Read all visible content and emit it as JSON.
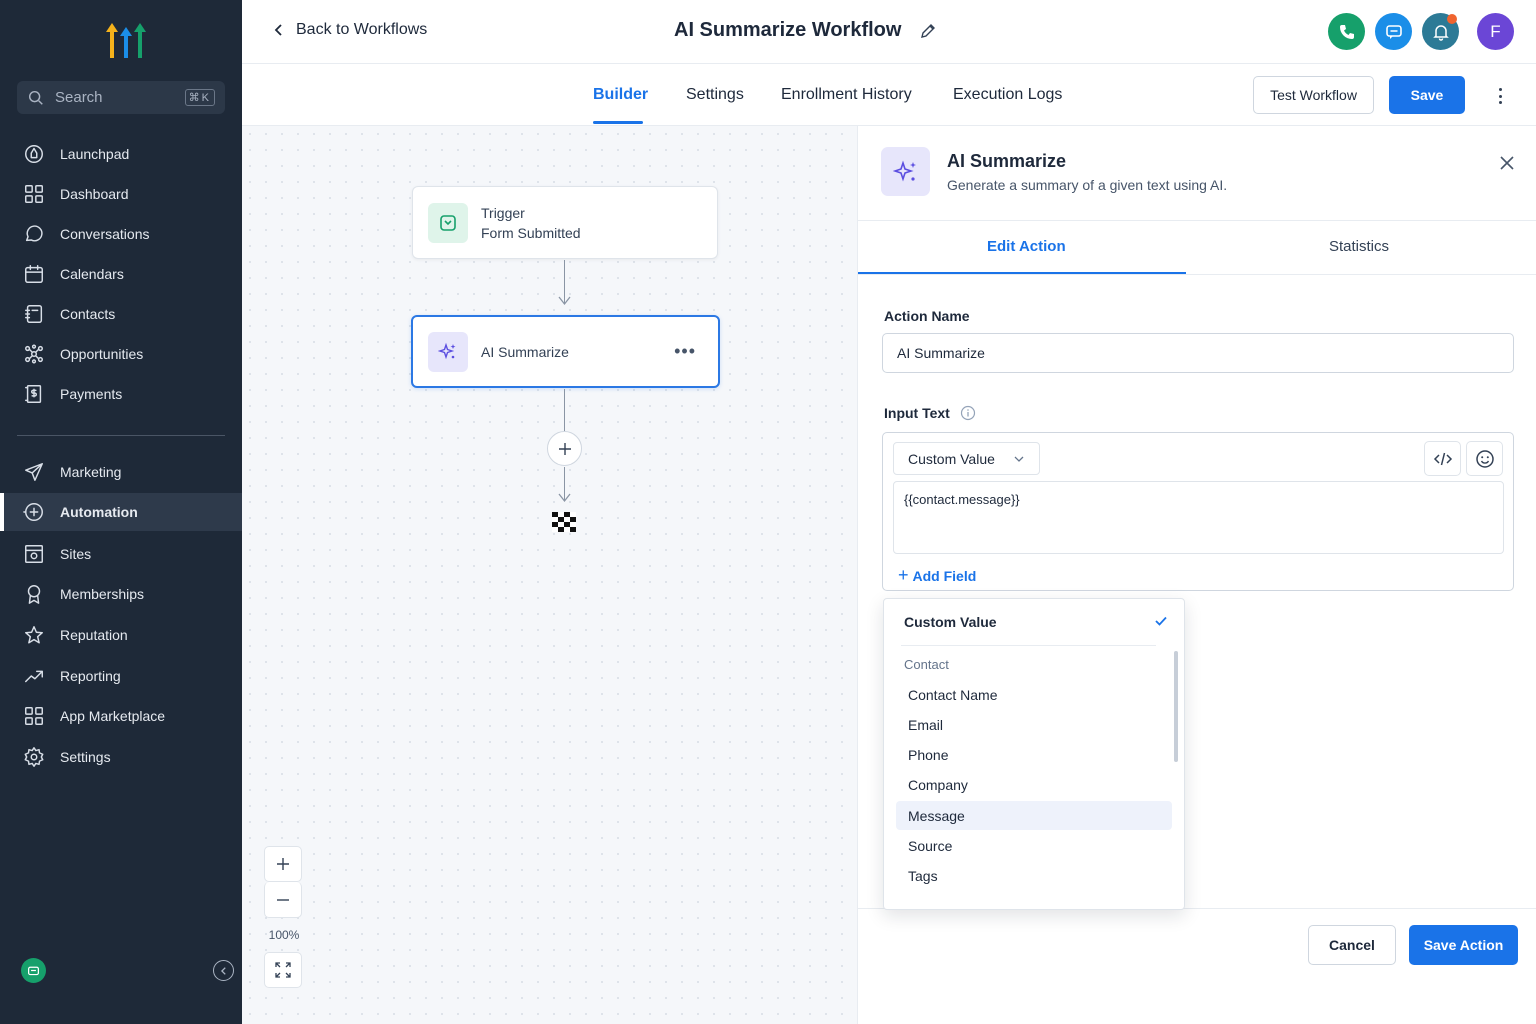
{
  "sidebar": {
    "search_placeholder": "Search",
    "search_shortcut": "⌘K",
    "items": [
      {
        "label": "Launchpad",
        "icon": "launchpad-icon"
      },
      {
        "label": "Dashboard",
        "icon": "dashboard-icon"
      },
      {
        "label": "Conversations",
        "icon": "chat-bubble-icon"
      },
      {
        "label": "Calendars",
        "icon": "calendar-icon"
      },
      {
        "label": "Contacts",
        "icon": "contacts-icon"
      },
      {
        "label": "Opportunities",
        "icon": "opportunities-icon"
      },
      {
        "label": "Payments",
        "icon": "payments-icon"
      },
      {
        "label": "Marketing",
        "icon": "send-icon"
      },
      {
        "label": "Automation",
        "icon": "automation-icon",
        "active": true
      },
      {
        "label": "Sites",
        "icon": "sites-icon"
      },
      {
        "label": "Memberships",
        "icon": "award-icon"
      },
      {
        "label": "Reputation",
        "icon": "star-icon"
      },
      {
        "label": "Reporting",
        "icon": "trend-icon"
      },
      {
        "label": "App Marketplace",
        "icon": "grid-icon"
      },
      {
        "label": "Settings",
        "icon": "gear-icon"
      }
    ]
  },
  "header": {
    "back_label": "Back to Workflows",
    "title": "AI Summarize Workflow",
    "avatar_initial": "F"
  },
  "tabs": {
    "builder": "Builder",
    "settings": "Settings",
    "enrollment": "Enrollment History",
    "logs": "Execution Logs",
    "test_workflow": "Test Workflow",
    "save": "Save"
  },
  "canvas": {
    "trigger_label": "Trigger",
    "trigger_value": "Form Submitted",
    "action_label": "AI Summarize",
    "zoom_level": "100%"
  },
  "panel": {
    "title": "AI Summarize",
    "description": "Generate a summary of a given text using AI.",
    "tab_edit": "Edit Action",
    "tab_stats": "Statistics",
    "action_name_label": "Action Name",
    "action_name_value": "AI Summarize",
    "input_text_label": "Input Text",
    "select_value": "Custom Value",
    "text_value": "{{contact.message}}",
    "add_field": "Add Field",
    "cancel": "Cancel",
    "save_action": "Save Action"
  },
  "dropdown": {
    "selected": "Custom Value",
    "group": "Contact",
    "items": [
      "Contact Name",
      "Email",
      "Phone",
      "Company",
      "Message",
      "Source",
      "Tags"
    ],
    "highlighted": "Message"
  },
  "colors": {
    "sidebar_bg": "#1e2938",
    "accent": "#1a73e8",
    "phone": "#16a06b",
    "chat": "#1b8ee8",
    "bell": "#2c7a96",
    "avatar": "#6b46d6",
    "notification": "#f0642f"
  }
}
